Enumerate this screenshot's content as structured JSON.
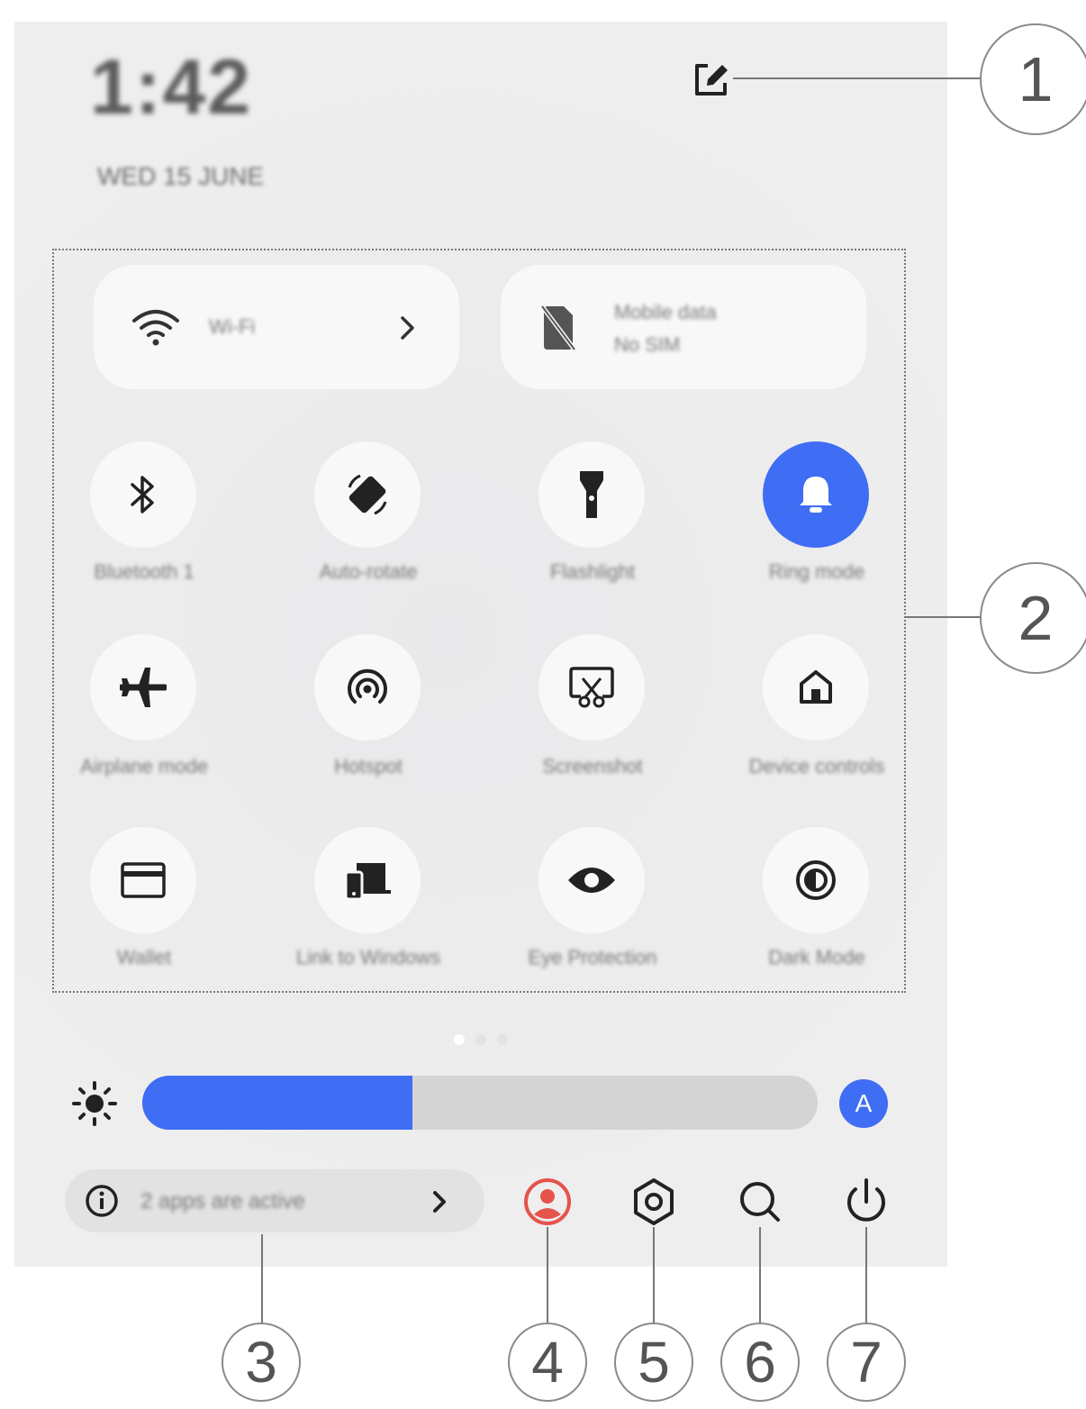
{
  "status": {
    "time": "1:42",
    "date": "WED 15 JUNE"
  },
  "network": {
    "wifi_name": "Wi-Fi",
    "data_title": "Mobile data",
    "data_sub": "No SIM"
  },
  "tiles": [
    {
      "label": "Bluetooth 1",
      "icon": "bluetooth-icon",
      "active": false
    },
    {
      "label": "Auto-rotate",
      "icon": "rotate-icon",
      "active": false
    },
    {
      "label": "Flashlight",
      "icon": "flashlight-icon",
      "active": false
    },
    {
      "label": "Ring mode",
      "icon": "bell-icon",
      "active": true
    },
    {
      "label": "Airplane mode",
      "icon": "airplane-icon",
      "active": false
    },
    {
      "label": "Hotspot",
      "icon": "hotspot-icon",
      "active": false
    },
    {
      "label": "Screenshot",
      "icon": "screenshot-icon",
      "active": false
    },
    {
      "label": "Device controls",
      "icon": "home-icon",
      "active": false
    },
    {
      "label": "Wallet",
      "icon": "wallet-icon",
      "active": false
    },
    {
      "label": "Link to Windows",
      "icon": "devices-icon",
      "active": false
    },
    {
      "label": "Eye Protection",
      "icon": "eye-icon",
      "active": false
    },
    {
      "label": "Dark Mode",
      "icon": "dark-mode-icon",
      "active": false
    }
  ],
  "pager": {
    "pages": 3,
    "current": 1
  },
  "brightness": {
    "level_percent": 40,
    "auto_label": "A"
  },
  "footer": {
    "apps_active_text": "2 apps are active"
  },
  "callouts": [
    "1",
    "2",
    "3",
    "4",
    "5",
    "6",
    "7"
  ],
  "colors": {
    "accent": "#3f6df3",
    "user_icon": "#e5534b",
    "panel": "#ececed"
  }
}
